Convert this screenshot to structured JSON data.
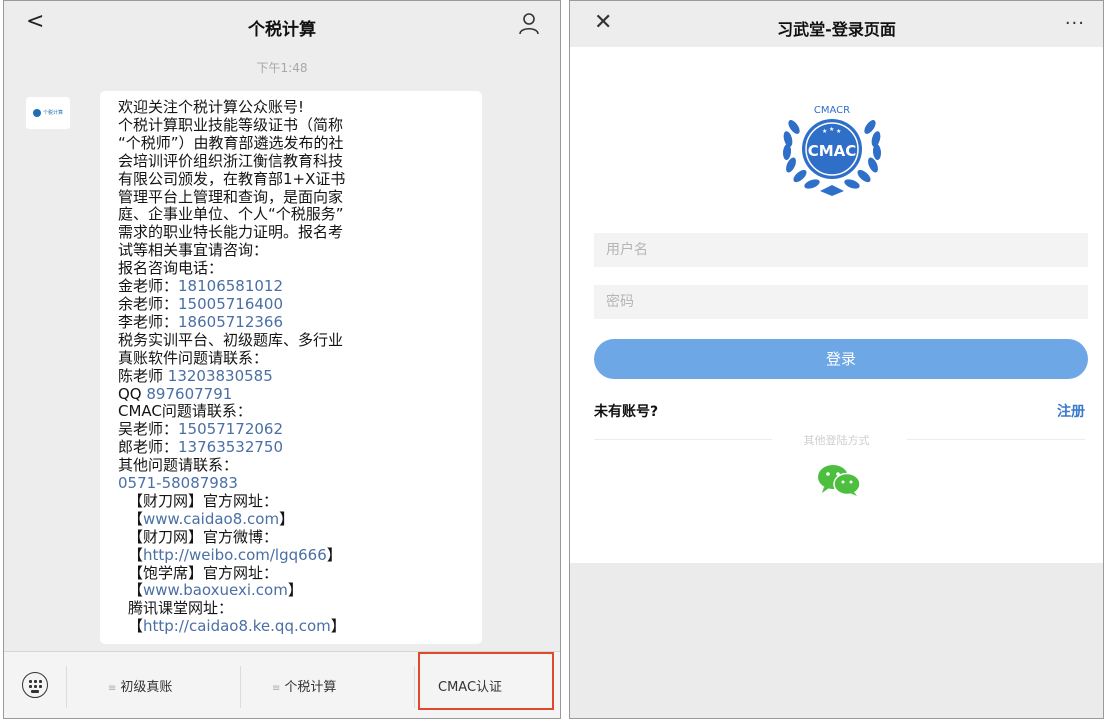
{
  "left": {
    "title": "个税计算",
    "back_glyph": "<",
    "time": "下午1:48",
    "avatar_label": "个税计算",
    "message_lines": [
      {
        "text": "欢迎关注个税计算公众账号!",
        "link": false
      },
      {
        "text": "个税计算职业技能等级证书（简称",
        "link": false
      },
      {
        "text": "“个税师”）由教育部遴选发布的社",
        "link": false
      },
      {
        "text": "会培训评价组织浙江衡信教育科技",
        "link": false
      },
      {
        "text": "有限公司颁发，在教育部1+X证书",
        "link": false
      },
      {
        "text": "管理平台上管理和查询，是面向家",
        "link": false
      },
      {
        "text": "庭、企事业单位、个人“个税服务”",
        "link": false
      },
      {
        "text": "需求的职业特长能力证明。报名考",
        "link": false
      },
      {
        "text": "试等相关事宜请咨询：",
        "link": false
      },
      {
        "text": "报名咨询电话：",
        "link": false
      },
      {
        "text": "金老师：",
        "link": false,
        "tail": "18106581012"
      },
      {
        "text": "余老师：",
        "link": false,
        "tail": "15005716400"
      },
      {
        "text": "李老师：",
        "link": false,
        "tail": "18605712366"
      },
      {
        "text": "税务实训平台、初级题库、多行业",
        "link": false
      },
      {
        "text": "真账软件问题请联系：",
        "link": false
      },
      {
        "text": "陈老师 ",
        "link": false,
        "tail": "13203830585"
      },
      {
        "text": "QQ ",
        "link": false,
        "tail": "897607791"
      },
      {
        "text": "CMAC问题请联系：",
        "link": false
      },
      {
        "text": "吴老师：",
        "link": false,
        "tail": "15057172062"
      },
      {
        "text": "郎老师：",
        "link": false,
        "tail": "13763532750"
      },
      {
        "text": "其他问题请联系：",
        "link": false
      },
      {
        "text": "0571-58087983",
        "link": true
      },
      {
        "text": "【财刀网】官方网址：",
        "link": false,
        "indent": true
      },
      {
        "text": "【",
        "link": false,
        "indent": true,
        "tail": "www.caidao8.com",
        "end": "】"
      },
      {
        "text": "【财刀网】官方微博：",
        "link": false,
        "indent": true
      },
      {
        "text": "【",
        "link": false,
        "indent": true,
        "tail": "http://weibo.com/lgq666",
        "end": "】"
      },
      {
        "text": "【饱学席】官方网址：",
        "link": false,
        "indent": true
      },
      {
        "text": "【",
        "link": false,
        "indent": true,
        "tail": "www.baoxuexi.com",
        "end": "】"
      },
      {
        "text": "腾讯课堂网址：",
        "link": false,
        "indent": true
      },
      {
        "text": "【",
        "link": false,
        "indent": true,
        "tail": "http://caidao8.ke.qq.com",
        "end": "】"
      }
    ],
    "menu": [
      {
        "label": "初级真账",
        "has_sub": true
      },
      {
        "label": "个税计算",
        "has_sub": true
      },
      {
        "label": "CMAC认证",
        "has_sub": false
      }
    ]
  },
  "right": {
    "title": "习武堂-登录页面",
    "close_glyph": "✕",
    "more_glyph": "···",
    "logo_text": "CMAC",
    "logo_arc_text": "CMACR",
    "username_placeholder": "用户名",
    "password_placeholder": "密码",
    "login_label": "登录",
    "no_account_label": "未有账号?",
    "register_label": "注册",
    "other_login_label": "其他登陆方式"
  },
  "colors": {
    "link": "#4a6fa5",
    "primary_button": "#5a9be2",
    "register_link": "#3a78c9",
    "highlight_box": "#e2482c",
    "wechat_green": "#4cbf3f",
    "logo_blue": "#2f6fc8"
  }
}
